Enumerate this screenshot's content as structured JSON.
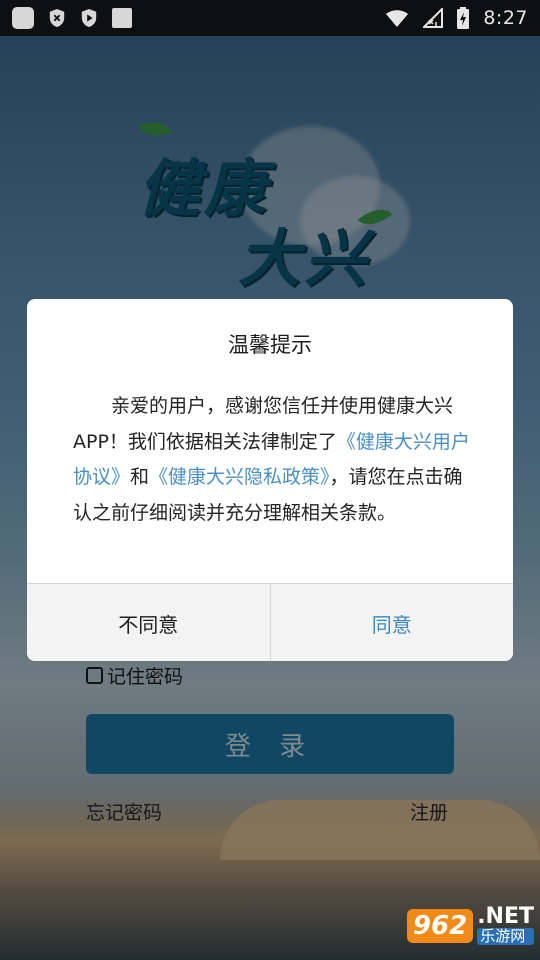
{
  "status_bar": {
    "time": "8:27",
    "icons": [
      "app-icon",
      "shield-x-icon",
      "shield-play-icon",
      "square-icon",
      "wifi-icon",
      "signal-icon",
      "battery-icon"
    ]
  },
  "logo": {
    "line1": "健康",
    "line2": "大兴",
    "color": "#0f5a7a"
  },
  "login_form": {
    "remember_label": "记住密码",
    "login_button": "登 录",
    "forgot_password": "忘记密码",
    "register": "注册",
    "accent": "#1c7ba9"
  },
  "dialog": {
    "title": "温馨提示",
    "body_part1": "亲爱的用户，感谢您信任并使用健康大兴APP！我们依据相关法律制定了",
    "link1": "《健康大兴用户协议》",
    "body_part2": "和",
    "link2": "《健康大兴隐私政策》",
    "body_part3": "，请您在点击确认之前仔细阅读并充分理解相关条款。",
    "disagree": "不同意",
    "agree": "同意",
    "link_color": "#4a90c4"
  },
  "watermark": {
    "badge": "962",
    "net": ".NET",
    "sub": "乐游网"
  }
}
